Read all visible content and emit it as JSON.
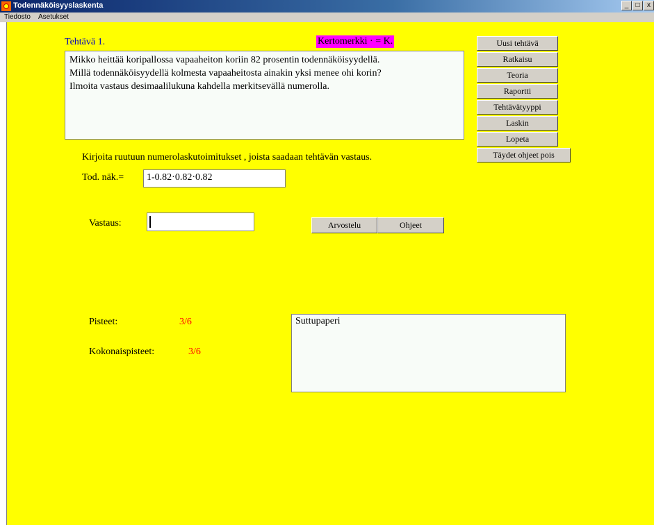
{
  "window": {
    "title": "Todennäköisyyslaskenta",
    "controls": {
      "minimize": "_",
      "maximize": "□",
      "close": "x"
    }
  },
  "menu": [
    "Tiedosto",
    "Asetukset"
  ],
  "task": {
    "number_label": "Tehtävä 1.",
    "multiply_hint": "Kertomerkki · = K.",
    "problem_lines": [
      "Mikko heittää koripallossa vapaaheiton koriin 82 prosentin todennäköisyydellä.",
      "Millä todennäköisyydellä kolmesta vapaaheitosta ainakin yksi menee ohi korin?",
      "Ilmoita vastaus desimaalilukuna kahdella merkitsevällä numerolla."
    ]
  },
  "side_buttons": [
    "Uusi tehtävä",
    "Ratkaisu",
    "Teoria",
    "Raportti",
    "Tehtävätyyppi",
    "Laskin",
    "Lopeta",
    "Täydet ohjeet pois"
  ],
  "work": {
    "instruction": "Kirjoita ruutuun numerolaskutoimitukset , joista saadaan tehtävän vastaus.",
    "probability_label": "Tod. näk.=",
    "probability_value": "1-0.82·0.82·0.82",
    "answer_label": "Vastaus:",
    "answer_value": ""
  },
  "actions": {
    "grade_label": "Arvostelu",
    "help_label": "Ohjeet"
  },
  "score": {
    "points_label": "Pisteet:",
    "points_value": "3/6",
    "total_label": "Kokonaispisteet:",
    "total_value": "3/6"
  },
  "scratchpad": {
    "title": "Suttupaperi"
  },
  "colors": {
    "background": "#ffff00",
    "accent_magenta": "#ff00ff",
    "task_blue": "#0000c0",
    "score_red": "#ff0000"
  }
}
